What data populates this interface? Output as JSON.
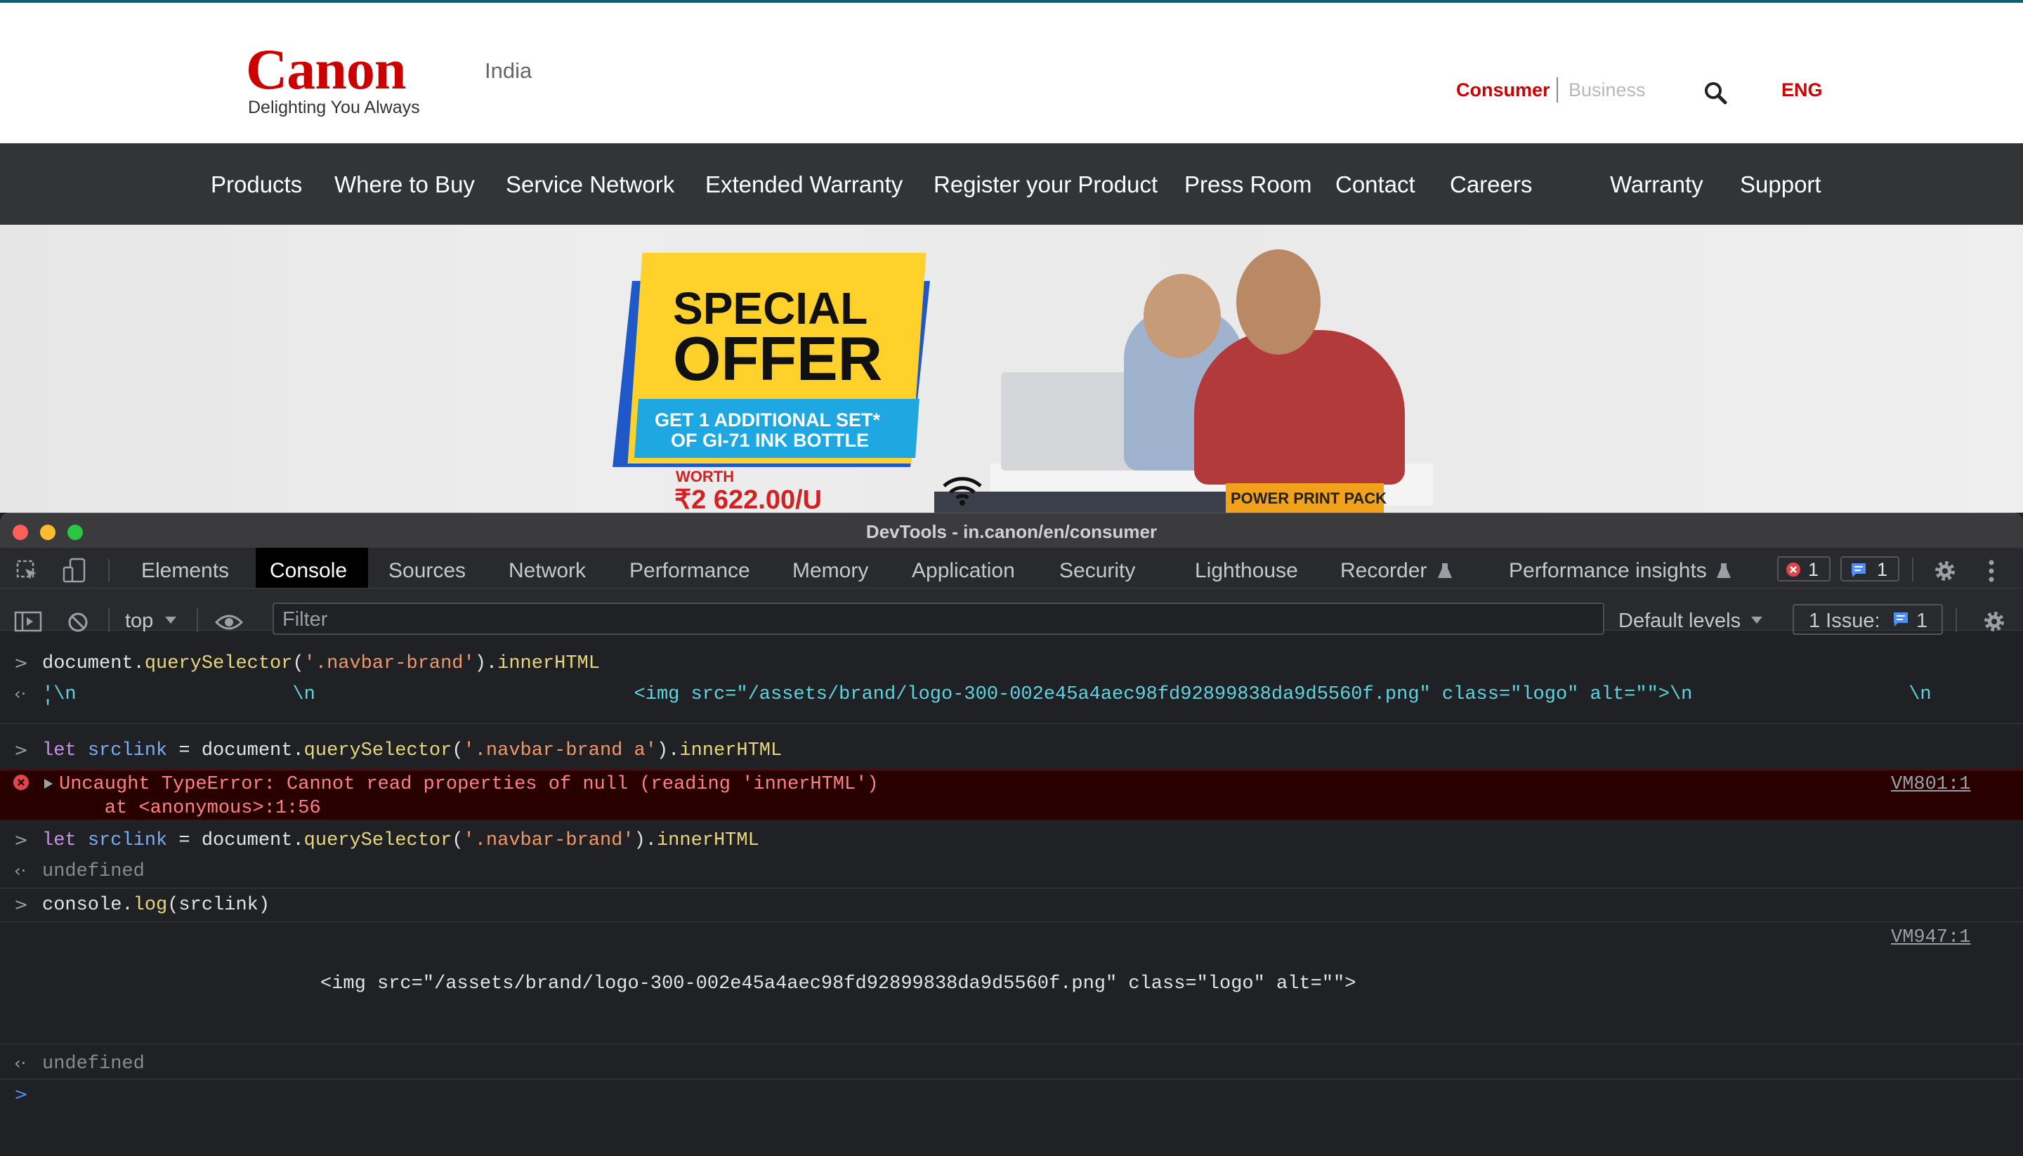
{
  "site": {
    "logo": "Canon",
    "tagline": "Delighting You Always",
    "country": "India",
    "consumer": "Consumer",
    "business": "Business",
    "language": "ENG",
    "nav": [
      "Products",
      "Where to Buy",
      "Service Network",
      "Extended Warranty",
      "Register your Product",
      "Press Room",
      "Contact",
      "Careers",
      "Warranty",
      "Support"
    ],
    "banner": {
      "special": "SPECIAL",
      "offer": "OFFER",
      "line1": "GET 1 ADDITIONAL SET*",
      "line2": "OF GI-71 INK BOTTLE",
      "worth": "WORTH",
      "price": "₹2 622.00/U",
      "pack": "POWER PRINT PACK"
    }
  },
  "devtools": {
    "title": "DevTools - in.canon/en/consumer",
    "tabs": [
      "Elements",
      "Console",
      "Sources",
      "Network",
      "Performance",
      "Memory",
      "Application",
      "Security",
      "Lighthouse",
      "Recorder",
      "Performance insights"
    ],
    "active_tab": "Console",
    "error_count": "1",
    "message_count": "1",
    "context": "top",
    "filter_placeholder": "Filter",
    "levels": "Default levels",
    "issues_label": "1 Issue:",
    "issues_count": "1",
    "console": {
      "l1": {
        "a": "document.",
        "b": "querySelector",
        "c": "(",
        "d": "'.navbar-brand'",
        "e": ").",
        "f": "innerHTML"
      },
      "r1a": "'\\n                   \\n                            <img src=\"/assets/brand/logo-300-002e45a4aec98fd92899838da9d5560f.png\" class=\"logo\" alt=\"\">\\n                   \\n",
      "r1b": "'",
      "l2": {
        "a": "let ",
        "b": "srclink",
        "c": " = document.",
        "d": "querySelector",
        "e": "(",
        "f": "'.navbar-brand a'",
        "g": ").",
        "h": "innerHTML"
      },
      "err1": "Uncaught TypeError: Cannot read properties of null (reading 'innerHTML')",
      "err2": "    at <anonymous>:1:56",
      "err_src": "VM801:1",
      "l3": {
        "a": "let ",
        "b": "srclink",
        "c": " = document.",
        "d": "querySelector",
        "e": "(",
        "f": "'.navbar-brand'",
        "g": ").",
        "h": "innerHTML"
      },
      "r3": "undefined",
      "l4": {
        "a": "console.",
        "b": "log",
        "c": "(srclink)"
      },
      "log_src": "VM947:1",
      "log_out": "<img src=\"/assets/brand/logo-300-002e45a4aec98fd92899838da9d5560f.png\" class=\"logo\" alt=\"\">",
      "r4": "undefined"
    }
  }
}
